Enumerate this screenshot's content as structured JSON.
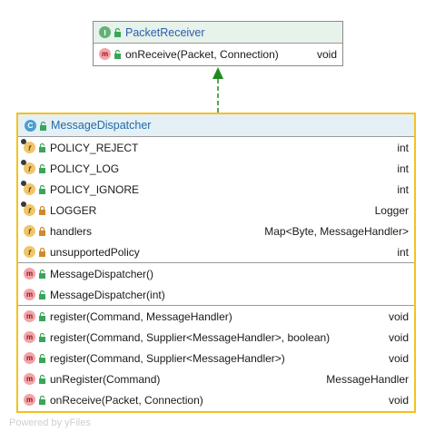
{
  "interface": {
    "kind_icon": "interface-icon",
    "kind_letter": "I",
    "name": "PacketReceiver",
    "methods": [
      {
        "name": "onReceive(Packet, Connection)",
        "type": "void",
        "visibility": "public"
      }
    ]
  },
  "class": {
    "kind_icon": "class-icon",
    "kind_letter": "C",
    "name": "MessageDispatcher",
    "fields": [
      {
        "name": "POLICY_REJECT",
        "type": "int",
        "visibility": "public",
        "static": true
      },
      {
        "name": "POLICY_LOG",
        "type": "int",
        "visibility": "public",
        "static": true
      },
      {
        "name": "POLICY_IGNORE",
        "type": "int",
        "visibility": "public",
        "static": true
      },
      {
        "name": "LOGGER",
        "type": "Logger",
        "visibility": "private",
        "static": true
      },
      {
        "name": "handlers",
        "type": "Map<Byte, MessageHandler>",
        "visibility": "private",
        "static": false
      },
      {
        "name": "unsupportedPolicy",
        "type": "int",
        "visibility": "private",
        "static": false
      }
    ],
    "constructors": [
      {
        "name": "MessageDispatcher()",
        "type": "",
        "visibility": "public"
      },
      {
        "name": "MessageDispatcher(int)",
        "type": "",
        "visibility": "public"
      }
    ],
    "methods": [
      {
        "name": "register(Command, MessageHandler)",
        "type": "void",
        "visibility": "public"
      },
      {
        "name": "register(Command, Supplier<MessageHandler>, boolean)",
        "type": "void",
        "visibility": "public"
      },
      {
        "name": "register(Command, Supplier<MessageHandler>)",
        "type": "void",
        "visibility": "public"
      },
      {
        "name": "unRegister(Command)",
        "type": "MessageHandler",
        "visibility": "public"
      },
      {
        "name": "onReceive(Packet, Connection)",
        "type": "void",
        "visibility": "public"
      }
    ]
  },
  "relation": {
    "type": "implements",
    "from": "MessageDispatcher",
    "to": "PacketReceiver"
  },
  "colors": {
    "class_border": "#f4c21d",
    "interface_border": "#8a8a8a",
    "arrow": "#1e8a1e",
    "public_marker": "#3aa55a",
    "private_marker": "#d08a2a"
  },
  "watermark": "Powered by yFiles",
  "method_letter": "m",
  "field_letter": "f"
}
